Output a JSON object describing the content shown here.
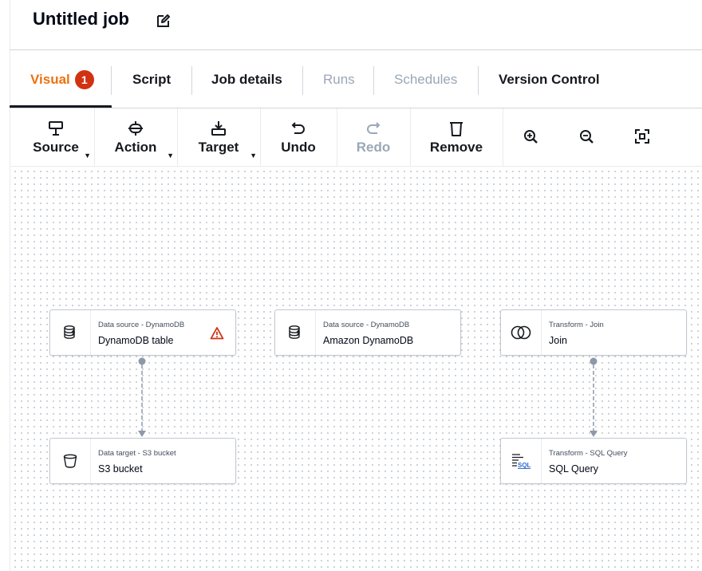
{
  "header": {
    "title": "Untitled job",
    "edit_icon": "edit-icon"
  },
  "tabs": [
    {
      "label": "Visual",
      "badge": "1",
      "state": "active"
    },
    {
      "label": "Script",
      "state": "normal"
    },
    {
      "label": "Job details",
      "state": "normal"
    },
    {
      "label": "Runs",
      "state": "disabled"
    },
    {
      "label": "Schedules",
      "state": "disabled"
    },
    {
      "label": "Version Control",
      "state": "normal"
    }
  ],
  "toolbar": {
    "source": {
      "label": "Source",
      "icon": "source-icon"
    },
    "action": {
      "label": "Action",
      "icon": "action-icon"
    },
    "target": {
      "label": "Target",
      "icon": "target-icon"
    },
    "undo": {
      "label": "Undo",
      "icon": "undo-icon"
    },
    "redo": {
      "label": "Redo",
      "icon": "redo-icon",
      "state": "disabled"
    },
    "remove": {
      "label": "Remove",
      "icon": "trash-icon"
    },
    "zoom_in_icon": "zoom-in-icon",
    "zoom_out_icon": "zoom-out-icon",
    "fit_icon": "fit-view-icon"
  },
  "nodes": {
    "dynamo_table": {
      "type": "Data source - DynamoDB",
      "name": "DynamoDB table",
      "warning": true
    },
    "amazon_dynamo": {
      "type": "Data source - DynamoDB",
      "name": "Amazon DynamoDB"
    },
    "join": {
      "type": "Transform - Join",
      "name": "Join"
    },
    "s3": {
      "type": "Data target - S3 bucket",
      "name": "S3 bucket"
    },
    "sql": {
      "type": "Transform - SQL Query",
      "name": "SQL Query"
    }
  },
  "colors": {
    "accent": "#ec7211",
    "badge": "#d13212",
    "warning": "#d13212",
    "text": "#16191f",
    "disabled": "#9ba7b6",
    "sql_blue": "#2f6dd1"
  }
}
